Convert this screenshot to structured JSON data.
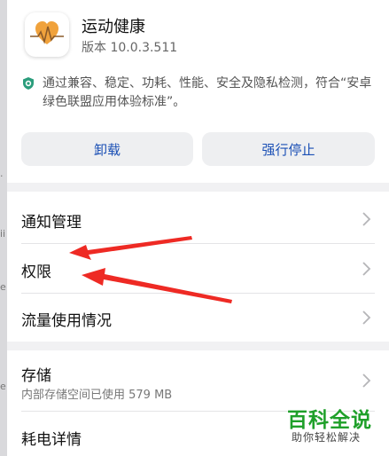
{
  "app": {
    "name": "运动健康",
    "version": "版本 10.0.3.511"
  },
  "certification": {
    "text": "通过兼容、稳定、功耗、性能、安全及隐私检测，符合“安卓绿色联盟应用体验标准”。",
    "icon": "shield-check-icon"
  },
  "actions": {
    "uninstall_label": "卸载",
    "force_stop_label": "强行停止"
  },
  "settings": {
    "items": [
      {
        "label": "通知管理"
      },
      {
        "label": "权限"
      },
      {
        "label": "流量使用情况"
      },
      {
        "label": "存储",
        "subtitle": "内部存储空间已使用 579 MB"
      },
      {
        "label": "耗电详情"
      }
    ]
  },
  "watermark": {
    "title": "百科全说",
    "subtitle": "助你轻松解决"
  },
  "colors": {
    "accent_blue": "#1a4fb5",
    "annotation_arrow": "#ee2a24",
    "watermark_green": "#1fa02a",
    "app_icon_heart": "#f0a23c"
  }
}
